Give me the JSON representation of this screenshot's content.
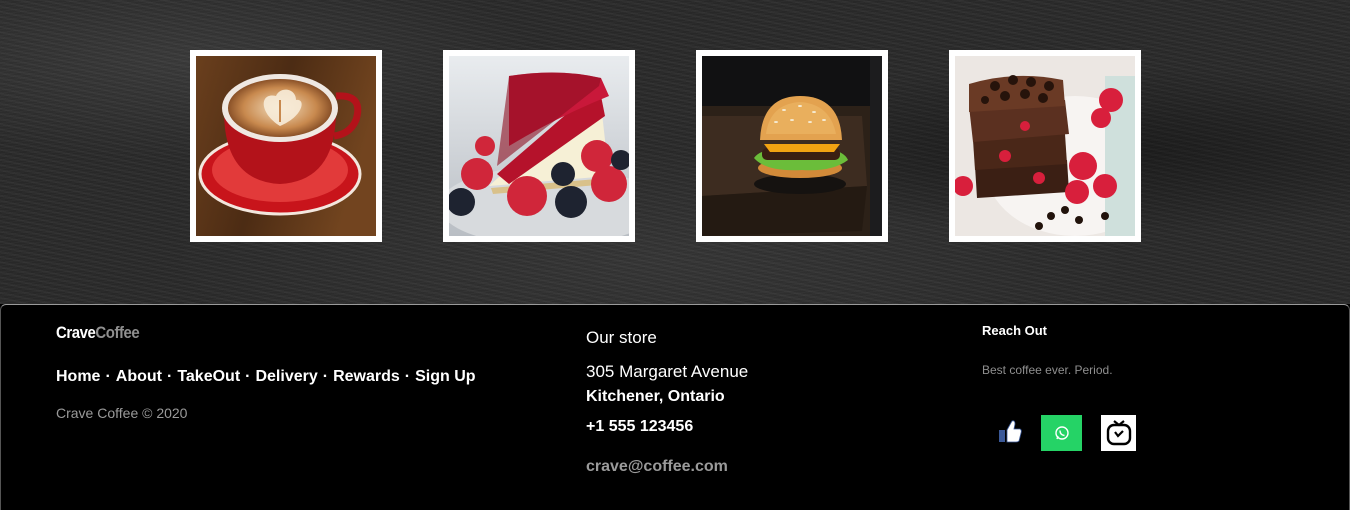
{
  "gallery": {
    "items": [
      {
        "name": "Latte"
      },
      {
        "name": "Raspberry cheesecake"
      },
      {
        "name": "Burger"
      },
      {
        "name": "Raspberry brownies"
      }
    ]
  },
  "footer": {
    "brand": {
      "part1": "Crave",
      "part2": "Coffee"
    },
    "nav": [
      {
        "label": "Home"
      },
      {
        "label": "About"
      },
      {
        "label": "TakeOut"
      },
      {
        "label": "Delivery"
      },
      {
        "label": "Rewards"
      },
      {
        "label": "Sign Up"
      }
    ],
    "nav_separator": "·",
    "copyright": "Crave Coffee © 2020",
    "store": {
      "heading": "Our store",
      "address_line1": "305 Margaret Avenue",
      "address_line2": "Kitchener, Ontario",
      "phone": "+1 555 123456",
      "email": "crave@coffee.com"
    },
    "reach": {
      "heading": "Reach Out",
      "tagline": "Best coffee ever. Period."
    },
    "social": [
      {
        "icon": "facebook-like-icon",
        "color": "#3b5998"
      },
      {
        "icon": "whatsapp-icon",
        "color": "#25d366"
      },
      {
        "icon": "igtv-icon",
        "color": "#000000"
      }
    ]
  }
}
